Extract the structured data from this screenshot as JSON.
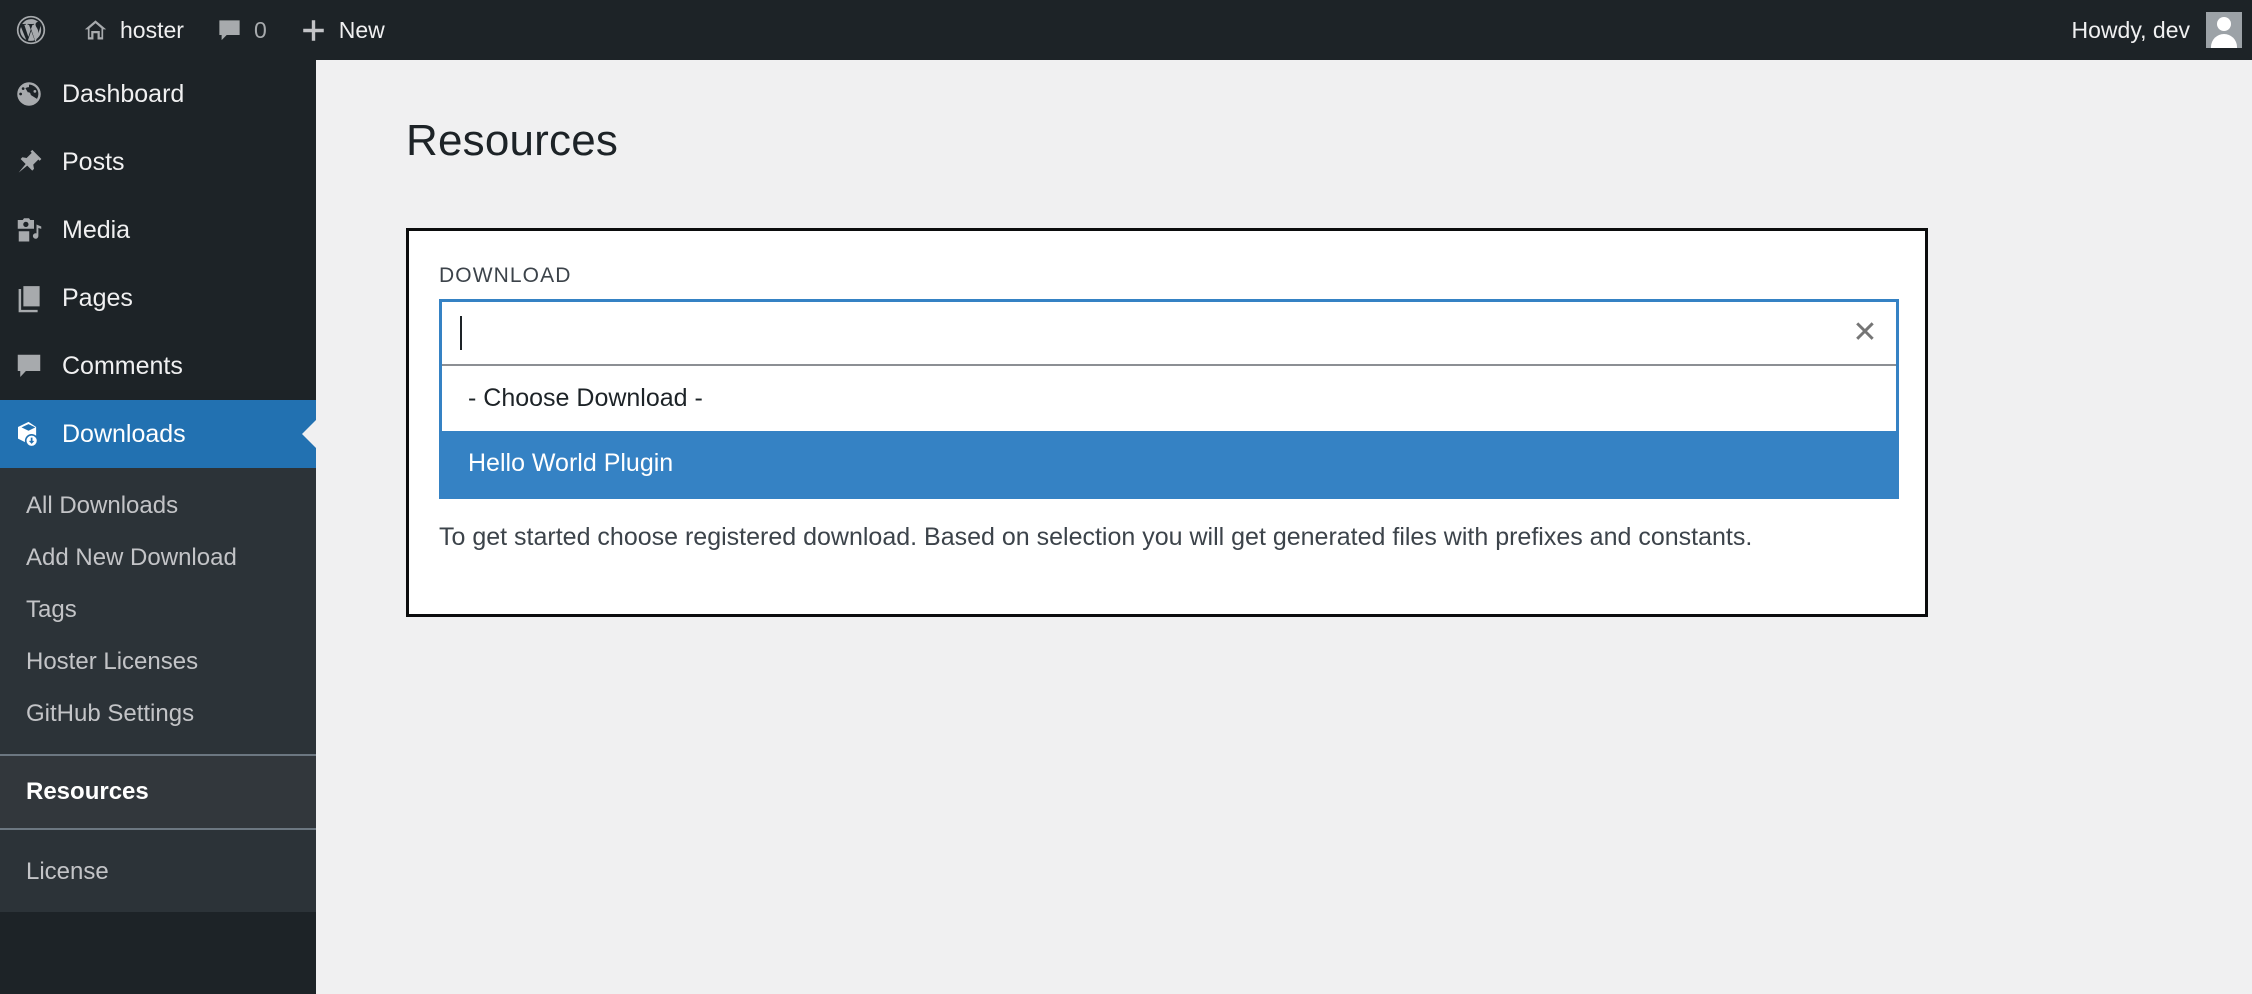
{
  "admin_bar": {
    "logo_icon": "wordpress-logo-icon",
    "site_icon": "home-icon",
    "site_name": "hoster",
    "comments_icon": "comment-bubble-icon",
    "comments_count": "0",
    "new_icon": "plus-icon",
    "new_label": "New",
    "howdy": "Howdy, dev",
    "avatar_icon": "user-avatar"
  },
  "sidebar": {
    "top_items": [
      {
        "label": "Dashboard",
        "icon": "dashboard-gauge-icon",
        "current": false
      },
      {
        "label": "Posts",
        "icon": "pushpin-icon",
        "current": false
      },
      {
        "label": "Media",
        "icon": "media-camera-music-icon",
        "current": false
      },
      {
        "label": "Pages",
        "icon": "pages-document-icon",
        "current": false
      },
      {
        "label": "Comments",
        "icon": "comment-bubble-icon",
        "current": false
      },
      {
        "label": "Downloads",
        "icon": "download-box-icon",
        "current": true
      }
    ],
    "submenu": [
      {
        "label": "All Downloads",
        "current": false
      },
      {
        "label": "Add New Download",
        "current": false
      },
      {
        "label": "Tags",
        "current": false
      },
      {
        "label": "Hoster Licenses",
        "current": false
      },
      {
        "label": "GitHub Settings",
        "current": false
      },
      {
        "label": "Resources",
        "current": true
      },
      {
        "label": "License",
        "current": false
      }
    ]
  },
  "main": {
    "page_title": "Resources",
    "field_label": "DOWNLOAD",
    "select": {
      "value": "",
      "placeholder": "",
      "clear_icon": "close-x-icon",
      "options": [
        {
          "label": "- Choose Download -",
          "selected": false
        },
        {
          "label": "Hello World Plugin",
          "selected": true
        }
      ]
    },
    "help_text": "To get started choose registered download. Based on selection you will get generated files with prefixes and constants."
  },
  "colors": {
    "admin_dark": "#1d2327",
    "submenu_dark": "#2c3338",
    "accent_blue": "#2271b1",
    "highlight_blue": "#3582c4",
    "content_bg": "#f0f0f1"
  }
}
